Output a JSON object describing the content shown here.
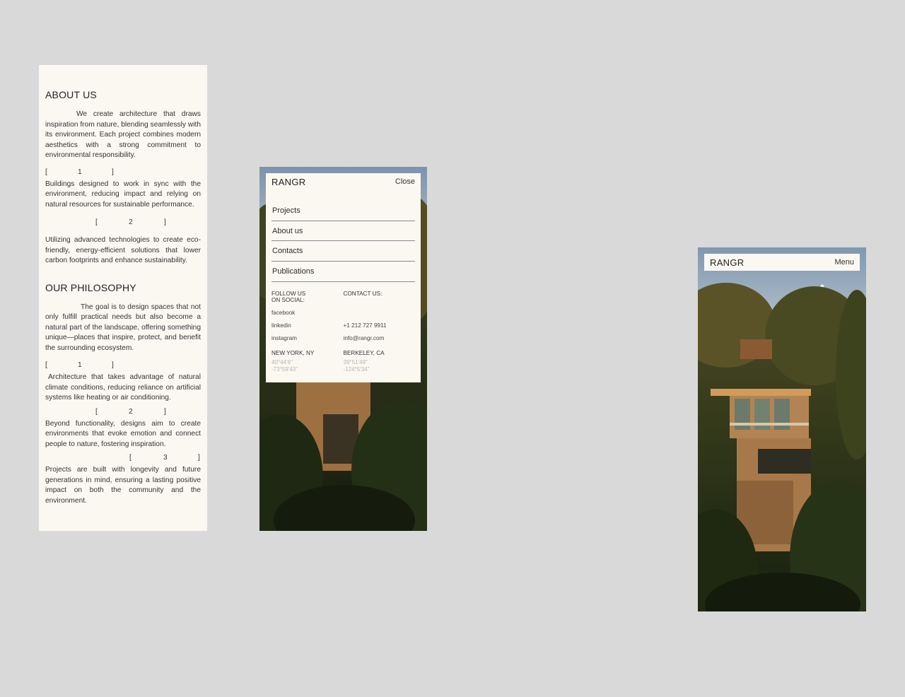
{
  "about": {
    "title": "ABOUT US",
    "intro": "We create architecture that draws inspiration from nature, blending seamlessly with its environment. Each project combines modern aesthetics with a strong commitment to environmental responsibility.",
    "points": [
      {
        "num": "1",
        "text": "Buildings designed to work in sync with the environment, reducing impact and relying on natural resources for sustainable performance."
      },
      {
        "num": "2",
        "text": "Utilizing advanced technologies to create eco-friendly, energy-efficient solutions that lower carbon footprints and enhance sustainability."
      }
    ]
  },
  "philosophy": {
    "title": "OUR PHILOSOPHY",
    "intro": "The goal is to design spaces that not only fulfill practical needs but also become a natural part of the landscape, offering something unique—places that inspire, protect, and benefit the surrounding ecosystem.",
    "points": [
      {
        "num": "1",
        "text": "Architecture that takes advantage of natural climate conditions, reducing reliance on artificial systems like heating or air conditioning."
      },
      {
        "num": "2",
        "text": "Beyond functionality, designs aim to create environments that evoke emotion and connect people to nature, fostering inspiration."
      },
      {
        "num": "3",
        "text": "Projects are built with longevity and future generations in mind, ensuring a lasting positive impact on both the community and the environment."
      }
    ]
  },
  "bracket_open": "[",
  "bracket_close": "]",
  "menu": {
    "brand": "RANGR",
    "close_label": "Close",
    "items": [
      "Projects",
      "About us",
      "Contacts",
      "Publications"
    ],
    "social_heading": "FOLLOW US ON SOCIAL:",
    "contact_heading": "CONTACT US:",
    "social_links": [
      "facebook",
      "linkedin",
      "instagram"
    ],
    "phone": "+1 212 727 9911",
    "email": "info@rangr.com",
    "offices": [
      {
        "city": "NEW YORK, NY",
        "lat": "40°44'6\"",
        "lon": "-73°59'43\""
      },
      {
        "city": "BERKELEY, CA",
        "lat": "39°51'49\"",
        "lon": "-124°5'34\""
      }
    ]
  },
  "header": {
    "brand": "RANGR",
    "menu_label": "Menu"
  },
  "colors": {
    "page_bg": "#d9d9d9",
    "card_bg": "#fbf8f2",
    "text": "#2a2a2a",
    "coord_text": "#b7b3ad"
  }
}
